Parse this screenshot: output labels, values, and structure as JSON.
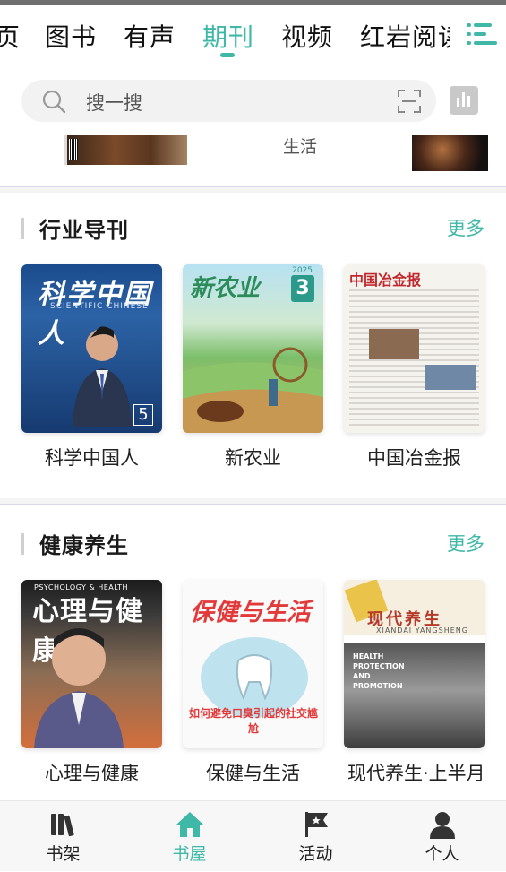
{
  "tabs": [
    {
      "label": "页",
      "active": false
    },
    {
      "label": "图书",
      "active": false
    },
    {
      "label": "有声",
      "active": false
    },
    {
      "label": "期刊",
      "active": true
    },
    {
      "label": "视频",
      "active": false
    },
    {
      "label": "红岩阅读",
      "active": false
    }
  ],
  "search": {
    "placeholder": "搜一搜"
  },
  "strip": {
    "label": "生活"
  },
  "sections": [
    {
      "title": "行业导刊",
      "more": "更多",
      "items": [
        {
          "title": "科学中国人",
          "cover_mast": "科学中国人",
          "cover_sub": "SCIENTIFIC CHINESE",
          "cover_num": "5"
        },
        {
          "title": "新农业",
          "cover_mast": "新农业",
          "cover_year": "2025",
          "cover_num": "3"
        },
        {
          "title": "中国冶金报",
          "cover_mast": "中国冶金报"
        }
      ]
    },
    {
      "title": "健康养生",
      "more": "更多",
      "items": [
        {
          "title": "心理与健康",
          "cover_mast": "心理与健康",
          "cover_eng": "PSYCHOLOGY & HEALTH"
        },
        {
          "title": "保健与生活",
          "cover_mast": "保健与生活",
          "cover_headline": "如何避免口臭引起的社交尴尬"
        },
        {
          "title": "现代养生·上半月",
          "cover_mast": "现代养生",
          "cover_py": "XIANDAI YANGSHENG",
          "cover_eng": "HEALTH PROTECTION AND PROMOTION"
        }
      ]
    }
  ],
  "bottom_nav": [
    {
      "label": "书架",
      "icon": "bookshelf-icon",
      "active": false
    },
    {
      "label": "书屋",
      "icon": "house-icon",
      "active": true
    },
    {
      "label": "活动",
      "icon": "flag-icon",
      "active": false
    },
    {
      "label": "个人",
      "icon": "person-icon",
      "active": false
    }
  ],
  "colors": {
    "accent": "#3fb8a7",
    "text": "#222222",
    "muted": "#555555"
  }
}
